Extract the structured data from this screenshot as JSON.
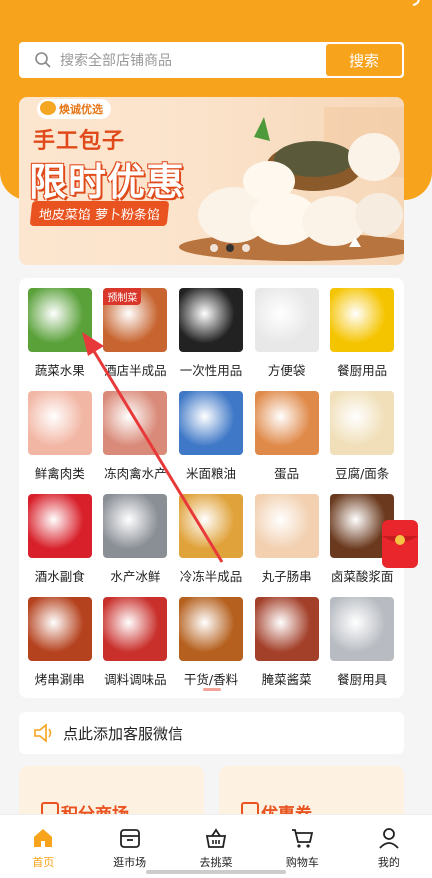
{
  "search": {
    "placeholder": "搜索全部店铺商品",
    "button_label": "搜索"
  },
  "banner": {
    "brand": "焕诚优选",
    "line1": "手工包子",
    "line2": "限时优惠",
    "tag": "地皮菜馅  萝卜粉条馅",
    "dots": 3,
    "active_dot": 1
  },
  "categories": [
    {
      "label": "蔬菜水果",
      "icon": "vegetables-icon",
      "color": "#5aa13a"
    },
    {
      "label": "酒店半成品",
      "icon": "prepared-dishes-icon",
      "color": "#c7642f",
      "badge": "预制菜"
    },
    {
      "label": "一次性用品",
      "icon": "disposable-box-icon",
      "color": "#222222"
    },
    {
      "label": "方便袋",
      "icon": "plastic-bag-icon",
      "color": "#e8e8e8"
    },
    {
      "label": "餐厨用品",
      "icon": "detergent-icon",
      "color": "#f5c400"
    },
    {
      "label": "鲜禽肉类",
      "icon": "poultry-icon",
      "color": "#f2b6a4"
    },
    {
      "label": "冻肉禽水产",
      "icon": "frozen-meat-icon",
      "color": "#d98a78"
    },
    {
      "label": "米面粮油",
      "icon": "rice-oil-icon",
      "color": "#3f78c7"
    },
    {
      "label": "蛋品",
      "icon": "eggs-icon",
      "color": "#e08a4a"
    },
    {
      "label": "豆腐/面条",
      "icon": "tofu-noodle-icon",
      "color": "#f0dfb8"
    },
    {
      "label": "酒水副食",
      "icon": "drinks-icon",
      "color": "#d8202a"
    },
    {
      "label": "水产冰鲜",
      "icon": "fish-icon",
      "color": "#8a8f96"
    },
    {
      "label": "冷冻半成品",
      "icon": "fried-food-icon",
      "color": "#e0a23a"
    },
    {
      "label": "丸子肠串",
      "icon": "meatballs-icon",
      "color": "#f2d0b0"
    },
    {
      "label": "卤菜酸浆面",
      "icon": "braised-food-icon",
      "color": "#6b3a1e"
    },
    {
      "label": "烤串涮串",
      "icon": "skewers-icon",
      "color": "#b5421e"
    },
    {
      "label": "调料调味品",
      "icon": "seasoning-icon",
      "color": "#c9302c"
    },
    {
      "label": "干货/香料",
      "icon": "spices-icon",
      "color": "#b5601e"
    },
    {
      "label": "腌菜酱菜",
      "icon": "pickles-icon",
      "color": "#a3402a"
    },
    {
      "label": "餐厨用具",
      "icon": "cookware-icon",
      "color": "#b8bcc2"
    }
  ],
  "notice": {
    "text": "点此添加客服微信",
    "icon": "speaker-icon"
  },
  "promos": {
    "left": "积分商场",
    "right": "优惠券"
  },
  "tabbar": [
    {
      "label": "首页",
      "icon": "home-icon",
      "active": true
    },
    {
      "label": "逛市场",
      "icon": "shop-icon",
      "active": false
    },
    {
      "label": "去挑菜",
      "icon": "basket-icon",
      "active": false
    },
    {
      "label": "购物车",
      "icon": "cart-icon",
      "active": false
    },
    {
      "label": "我的",
      "icon": "user-icon",
      "active": false
    }
  ],
  "colors": {
    "accent": "#f7a31b",
    "annotation": "#e8393a"
  }
}
